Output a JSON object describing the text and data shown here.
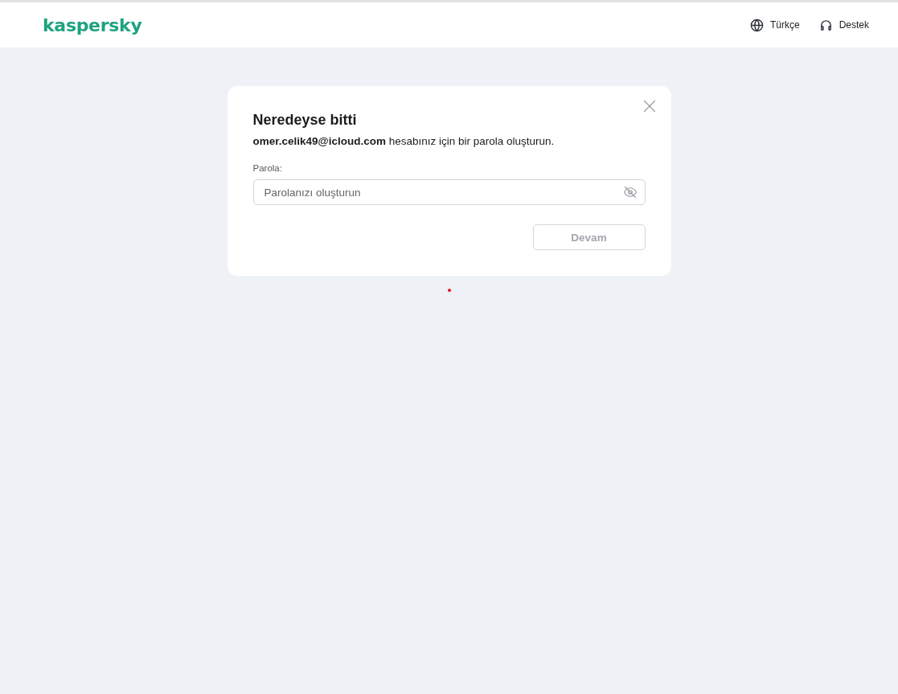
{
  "header": {
    "logo": "kaspersky",
    "links": [
      {
        "kind": "language",
        "label": "Türkçe"
      },
      {
        "kind": "support",
        "label": "Destek"
      }
    ]
  },
  "dialog": {
    "title": "Neredeyse bitti",
    "message": "**omer.celik49@icloud.com** hesabınız için bir parola oluşturun.",
    "field": {
      "label": "Parola:",
      "placeholder": "Parolanızı oluşturun"
    },
    "button": {
      "label": "Devam",
      "disabled": true
    }
  }
}
